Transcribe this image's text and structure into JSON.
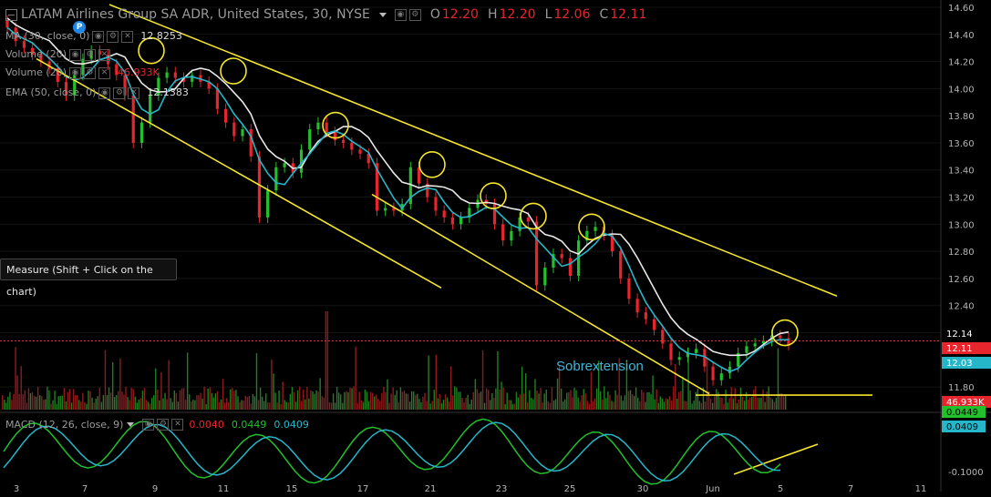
{
  "header": {
    "title": "LATAM Airlines Group SA ADR, United States, 30, NYSE",
    "open_label": "O",
    "open": "12.20",
    "high_label": "H",
    "high": "12.20",
    "low_label": "L",
    "low": "12.06",
    "close_label": "C",
    "close": "12.11"
  },
  "indicators": [
    {
      "label": "MA (30, close, 0)",
      "value": "12.8253"
    },
    {
      "label": "Volume (20)",
      "value": ""
    },
    {
      "label": "Volume (20)",
      "value": "46.933K"
    },
    {
      "label": "EMA (50, close, 0)",
      "value": "12.1383"
    }
  ],
  "tooltip": "Measure (Shift + Click on the chart)",
  "p_marker": "P",
  "annotation": "Sobrextension",
  "price_axis": {
    "ticks": [
      "14.60",
      "14.40",
      "14.20",
      "14.00",
      "13.80",
      "13.60",
      "13.40",
      "13.20",
      "13.00",
      "12.80",
      "12.60",
      "12.40",
      "12.20",
      "11.80"
    ],
    "labels": [
      {
        "text": "12.14",
        "color": "#ffffff"
      },
      {
        "text": "12.11",
        "color": "#e8242c"
      },
      {
        "text": "12.03",
        "color": "#25b7c9"
      },
      {
        "text": "46.933K",
        "color": "#e8242c"
      }
    ]
  },
  "macd": {
    "legend": "MACD (12, 26, close, 9)",
    "histogram": "0.0040",
    "macd": "0.0449",
    "signal": "0.0409",
    "axis_ticks": [
      "-0.1000"
    ],
    "axis_labels": [
      {
        "text": "0.0449",
        "color": "#22c02a"
      },
      {
        "text": "0.0409",
        "color": "#25b7c9"
      }
    ]
  },
  "time_axis": [
    "3",
    "7",
    "9",
    "11",
    "15",
    "17",
    "21",
    "23",
    "25",
    "30",
    "Jun",
    "5",
    "7",
    "11"
  ],
  "colors": {
    "up": "#22c02a",
    "down": "#e8242c",
    "ma": "#e8e8e8",
    "ema": "#25b7c9",
    "trendline": "#f5e62a",
    "circle": "#f5e62a"
  },
  "chart_data": {
    "type": "candlestick",
    "title": "LATAM Airlines Group SA ADR, United States, 30, NYSE",
    "ylim": [
      11.7,
      14.62
    ],
    "close_series": [
      14.45,
      14.35,
      14.3,
      14.25,
      14.2,
      14.15,
      14.05,
      13.95,
      14.1,
      14.22,
      14.28,
      14.25,
      14.18,
      14.1,
      13.95,
      13.6,
      13.75,
      13.95,
      14.08,
      14.12,
      14.08,
      14.05,
      14.1,
      14.05,
      14.0,
      13.85,
      13.75,
      13.65,
      13.7,
      13.5,
      13.05,
      13.25,
      13.42,
      13.45,
      13.38,
      13.55,
      13.7,
      13.75,
      13.68,
      13.62,
      13.6,
      13.55,
      13.52,
      13.45,
      13.1,
      13.12,
      13.1,
      13.15,
      13.42,
      13.3,
      13.2,
      13.1,
      13.05,
      13.0,
      13.05,
      13.12,
      13.18,
      13.15,
      13.0,
      12.88,
      12.95,
      13.05,
      13.02,
      12.55,
      12.68,
      12.78,
      12.75,
      12.62,
      12.88,
      12.95,
      12.98,
      12.92,
      12.8,
      12.6,
      12.45,
      12.35,
      12.3,
      12.22,
      12.12,
      12.0,
      12.02,
      12.05,
      12.08,
      11.95,
      11.85,
      11.9,
      11.95,
      12.05,
      12.1,
      12.12,
      12.14,
      12.18,
      12.16,
      12.11
    ],
    "ma_30_last": 12.8253,
    "ema_50_last": 12.1383,
    "last": {
      "open": 12.2,
      "high": 12.2,
      "low": 12.06,
      "close": 12.11
    },
    "macd": {
      "histogram": 0.004,
      "macd": 0.0449,
      "signal": 0.0409
    }
  }
}
